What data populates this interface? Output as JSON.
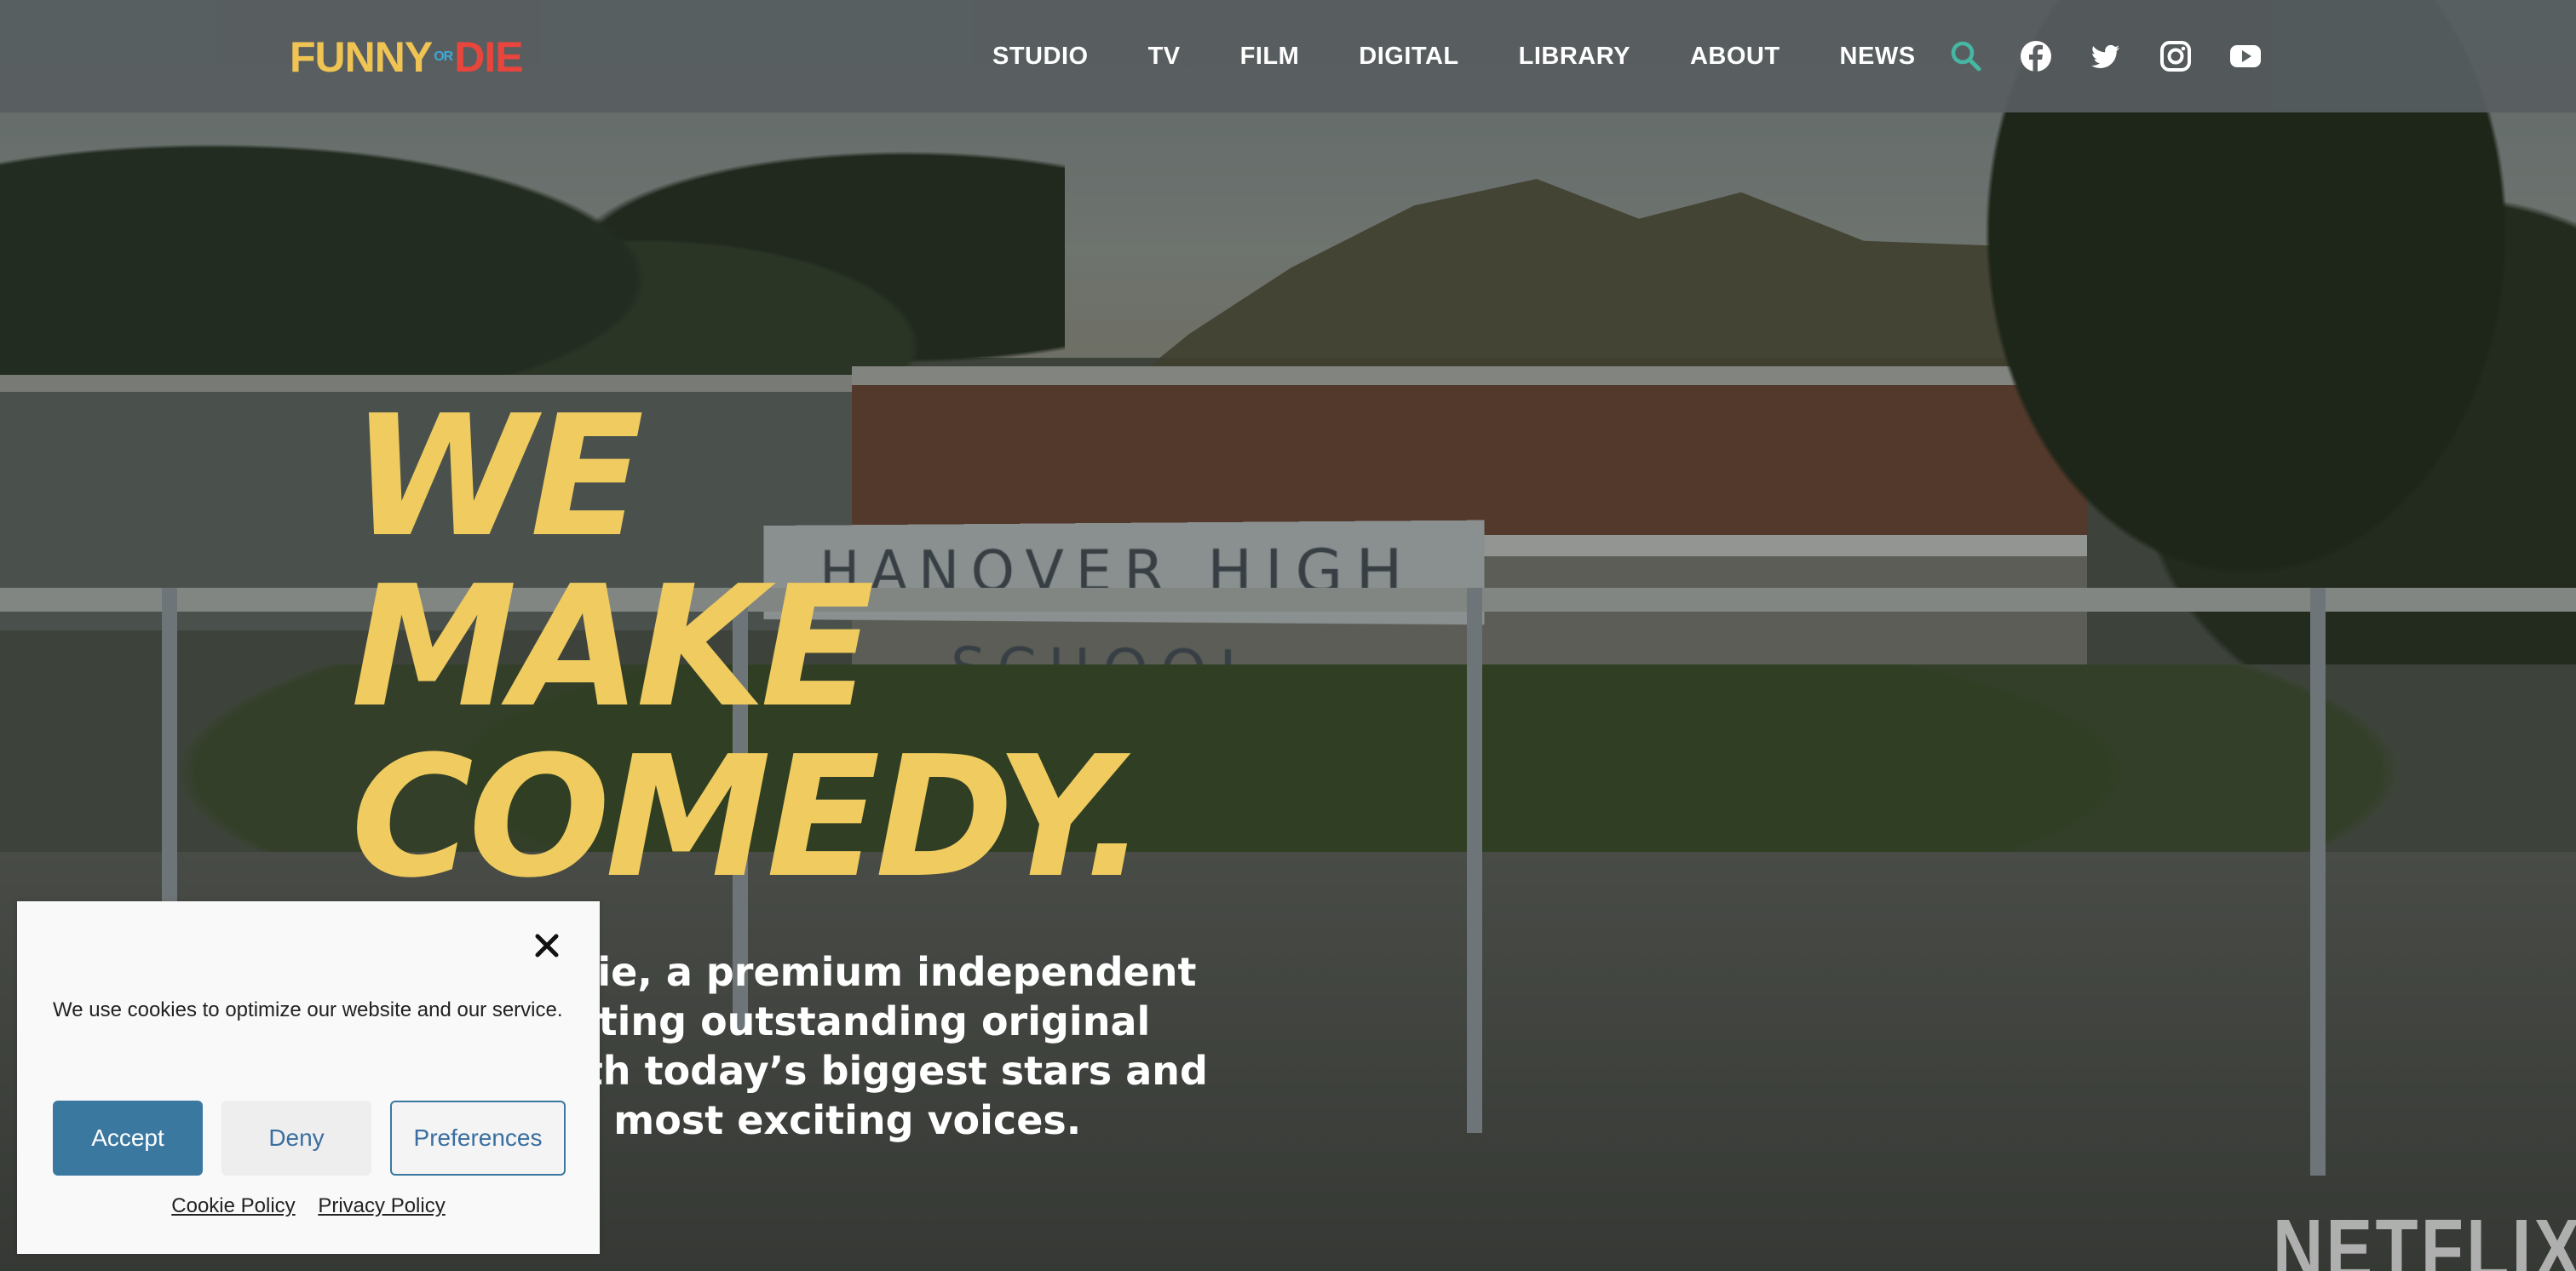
{
  "brand": {
    "logo_funny": "FUNNY",
    "logo_or": "OR",
    "logo_die": "DIE",
    "colors": {
      "yellow": "#f0c453",
      "blue": "#3ba9d6",
      "red": "#e8453c"
    }
  },
  "nav": {
    "items": [
      {
        "label": "STUDIO"
      },
      {
        "label": "TV"
      },
      {
        "label": "FILM"
      },
      {
        "label": "DIGITAL"
      },
      {
        "label": "LIBRARY"
      },
      {
        "label": "ABOUT"
      },
      {
        "label": "NEWS"
      }
    ]
  },
  "header_icons": [
    "search-icon",
    "facebook-icon",
    "twitter-icon",
    "instagram-icon",
    "youtube-icon"
  ],
  "hero": {
    "headline_line1": "WE",
    "headline_line2": "MAKE",
    "headline_line3": "COMEDY.",
    "subcopy": "Funny Or Die, a premium independent studio creating outstanding original content with today’s biggest stars and the world’s most exciting voices.",
    "headline_color": "#efcb60",
    "background_sign": "HANOVER HIGH SCHOOL",
    "watermark": "NETFLIX"
  },
  "cookie_banner": {
    "message": "We use cookies to optimize our website and our service.",
    "accept_label": "Accept",
    "deny_label": "Deny",
    "preferences_label": "Preferences",
    "cookie_policy_label": "Cookie Policy",
    "privacy_policy_label": "Privacy Policy",
    "accent_color": "#3a78a0"
  }
}
